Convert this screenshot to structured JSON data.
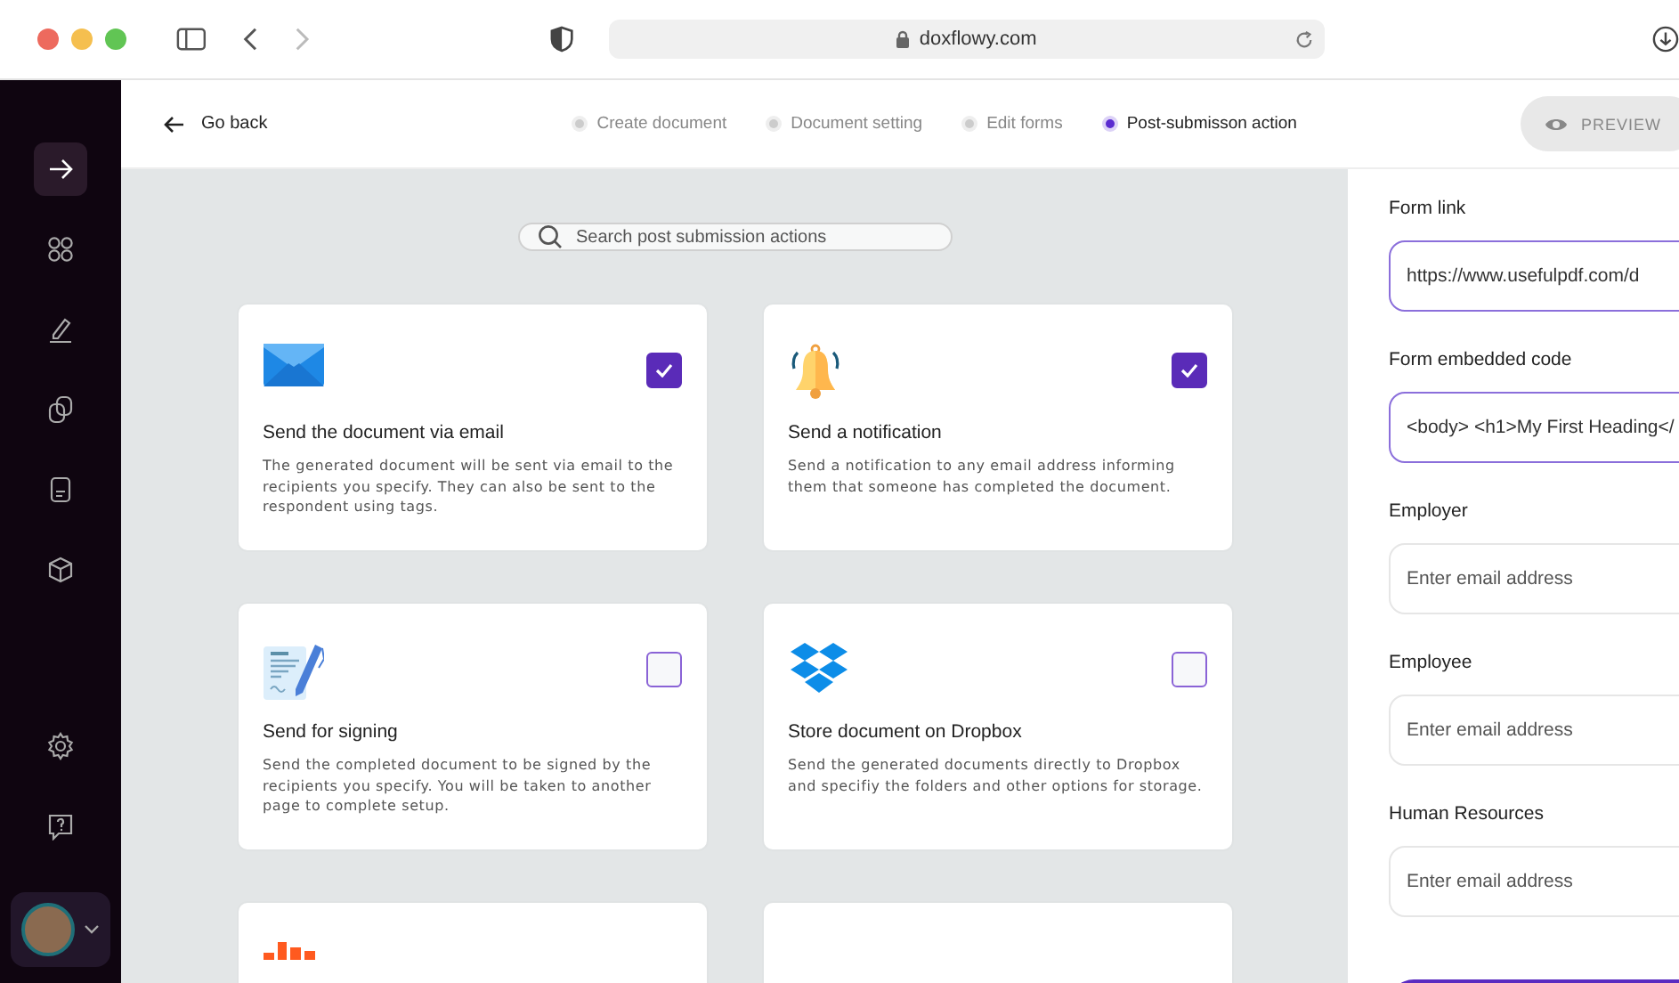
{
  "browser": {
    "url": "doxflowy.com"
  },
  "sidebar": {
    "items": [
      {
        "selected": true
      },
      {
        "selected": false
      },
      {
        "selected": false
      },
      {
        "selected": false
      },
      {
        "selected": false
      },
      {
        "selected": false
      }
    ]
  },
  "topbar": {
    "back": "Go back",
    "steps": [
      {
        "label": "Create document",
        "selected": false
      },
      {
        "label": "Document setting",
        "selected": false
      },
      {
        "label": "Edit forms",
        "selected": false
      },
      {
        "label": "Post-submisson action",
        "selected": true
      }
    ],
    "preview": "PREVIEW"
  },
  "search": {
    "placeholder": "Search post submission actions"
  },
  "cards": [
    {
      "kind": "action",
      "title": "Send the document via email",
      "description": "The generated document will be sent via email to the recipients you specify. They can also be sent to the respondent using tags.",
      "checked": true
    },
    {
      "kind": "action",
      "title": "Send a notification",
      "description": "Send a notification to any email address informing them that someone has completed the document.",
      "checked": true
    },
    {
      "kind": "action",
      "title": "Send for signing",
      "description": "Send the completed document to be signed by the recipients you specify. You will be taken to another page to complete setup.",
      "checked": false
    },
    {
      "kind": "action",
      "title": "Store document on Dropbox",
      "description": "Send the generated documents directly to Dropbox and specifiy the folders and other options for storage.",
      "checked": false
    },
    {
      "kind": "partial"
    },
    {
      "kind": "partial"
    }
  ],
  "panel": {
    "fields": [
      {
        "label": "Form link",
        "value": "https://www.usefulpdf.com/d",
        "focused": true
      },
      {
        "label": "Form embedded code",
        "value": "<body> <h1>My First Heading</",
        "focused": true
      },
      {
        "label": "Employer",
        "placeholder": "Enter email address",
        "focused": false
      },
      {
        "label": "Employee",
        "placeholder": "Enter email address",
        "focused": false
      },
      {
        "label": "Human Resources",
        "placeholder": "Enter email address",
        "focused": false
      }
    ]
  }
}
